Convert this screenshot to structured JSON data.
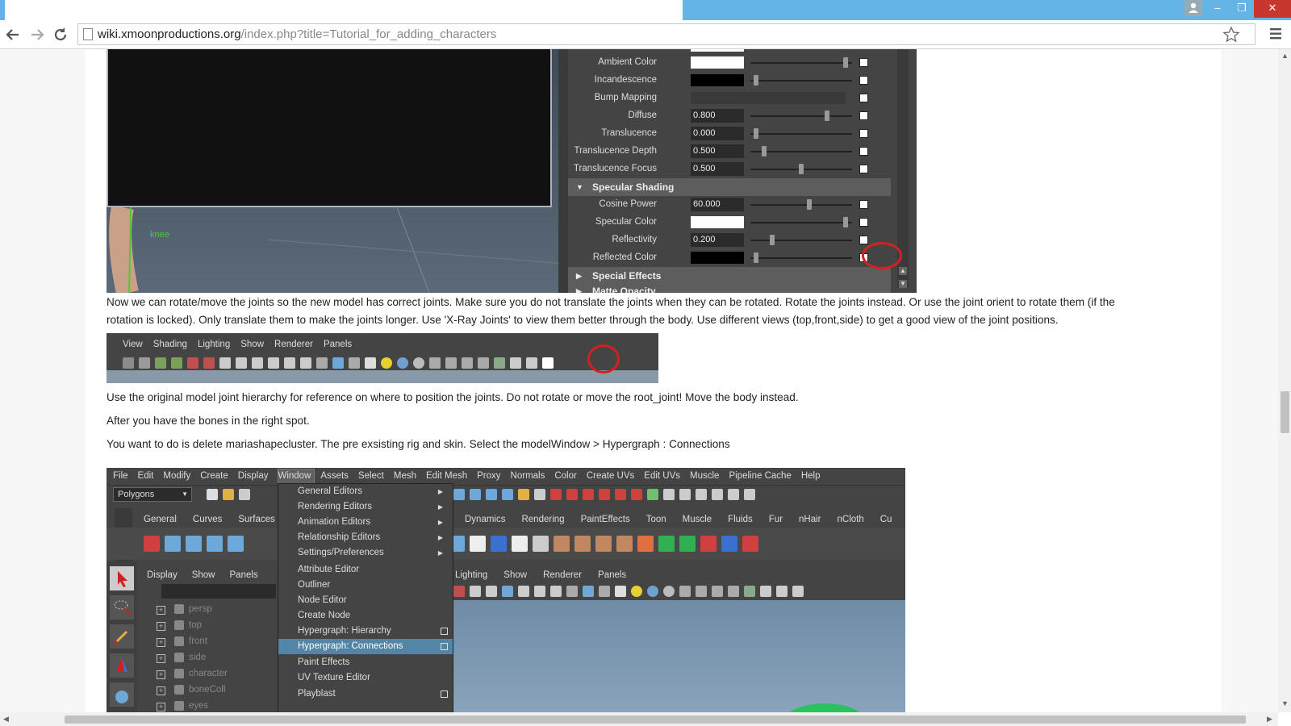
{
  "browser": {
    "url_host": "wiki.xmoonproductions.org",
    "url_path": "/index.php?title=Tutorial_for_adding_characters",
    "back_icon": "arrow-left-icon",
    "forward_icon": "arrow-right-icon",
    "reload_icon": "reload-icon",
    "star_icon": "star-icon",
    "menu_icon": "hamburger-menu-icon",
    "window_controls": {
      "minimize": "–",
      "maximize": "❐",
      "close": "✕"
    }
  },
  "article": {
    "para1_line1": "Now we can rotate/move the joints so the new model has correct joints. Make sure you do not translate the joints when they can be rotated. Rotate the joints instead. Or use the joint orient to rotate them (if the",
    "para1_line2": "rotation is locked). Only translate them to make the joints longer. Use 'X-Ray Joints' to view them better through the body. Use different views (top,front,side) to get a good view of the joint positions.",
    "para2": "Use the original model joint hierarchy for reference on where to position the joints. Do not rotate or move the root_joint! Move the body instead.",
    "para3": "After you have the bones in the right spot.",
    "para4": "You want to do is delete mariashapecluster. The pre exsisting rig and skin. Select the modelWindow > Hypergraph : Connections"
  },
  "screenshot1": {
    "viewport_label": "knee",
    "attributes": [
      {
        "label": "Ambient Color",
        "kind": "swatch",
        "color": "#ffffff",
        "level": 0.96
      },
      {
        "label": "Incandescence",
        "kind": "swatch",
        "color": "#000000",
        "level": 0.03
      },
      {
        "label": "Bump Mapping",
        "kind": "empty"
      },
      {
        "label": "Diffuse",
        "kind": "field",
        "value": "0.800",
        "level": 0.77
      },
      {
        "label": "Translucence",
        "kind": "field",
        "value": "0.000",
        "level": 0.03
      },
      {
        "label": "Translucence Depth",
        "kind": "field",
        "value": "0.500",
        "level": 0.12
      },
      {
        "label": "Translucence Focus",
        "kind": "field",
        "value": "0.500",
        "level": 0.5
      }
    ],
    "specular_header": "Specular Shading",
    "specular": [
      {
        "label": "Cosine Power",
        "kind": "field",
        "value": "60.000",
        "level": 0.58
      },
      {
        "label": "Specular Color",
        "kind": "swatch",
        "color": "#ffffff",
        "level": 0.96
      },
      {
        "label": "Reflectivity",
        "kind": "field",
        "value": "0.200",
        "level": 0.2
      },
      {
        "label": "Reflected Color",
        "kind": "swatch",
        "color": "#000000",
        "level": 0.03
      }
    ],
    "special_effects": "Special Effects",
    "matte_opacity": "Matte Opacity"
  },
  "screenshot2": {
    "menu": [
      "View",
      "Shading",
      "Lighting",
      "Show",
      "Renderer",
      "Panels"
    ]
  },
  "screenshot3": {
    "menubar": [
      "File",
      "Edit",
      "Modify",
      "Create",
      "Display",
      "Window",
      "Assets",
      "Select",
      "Mesh",
      "Edit Mesh",
      "Proxy",
      "Normals",
      "Color",
      "Create UVs",
      "Edit UVs",
      "Muscle",
      "Pipeline Cache",
      "Help"
    ],
    "mode_select": "Polygons",
    "shelf_tabs_left": [
      "General",
      "Curves",
      "Surfaces"
    ],
    "shelf_tabs_right": [
      "Dynamics",
      "Rendering",
      "PaintEffects",
      "Toon",
      "Muscle",
      "Fluids",
      "Fur",
      "nHair",
      "nCloth",
      "Cu"
    ],
    "outliner_menu": [
      "Display",
      "Show",
      "Panels"
    ],
    "panel_menu": [
      "Lighting",
      "Show",
      "Renderer",
      "Panels"
    ],
    "outliner_items": [
      "persp",
      "top",
      "front",
      "side",
      "character",
      "boneColl",
      "eyes"
    ],
    "window_menu_items": [
      {
        "label": "General Editors",
        "type": "sub"
      },
      {
        "label": "Rendering Editors",
        "type": "sub"
      },
      {
        "label": "Animation Editors",
        "type": "sub"
      },
      {
        "label": "Relationship Editors",
        "type": "sub"
      },
      {
        "label": "Settings/Preferences",
        "type": "sub"
      },
      {
        "label": "Attribute Editor",
        "type": "plain"
      },
      {
        "label": "Outliner",
        "type": "plain"
      },
      {
        "label": "Node Editor",
        "type": "plain"
      },
      {
        "label": "Create Node",
        "type": "plain"
      },
      {
        "label": "Hypergraph: Hierarchy",
        "type": "opt"
      },
      {
        "label": "Hypergraph: Connections",
        "type": "opt-selected"
      },
      {
        "label": "Paint Effects",
        "type": "plain"
      },
      {
        "label": "UV Texture Editor",
        "type": "plain"
      },
      {
        "label": "Playblast",
        "type": "opt"
      }
    ]
  }
}
